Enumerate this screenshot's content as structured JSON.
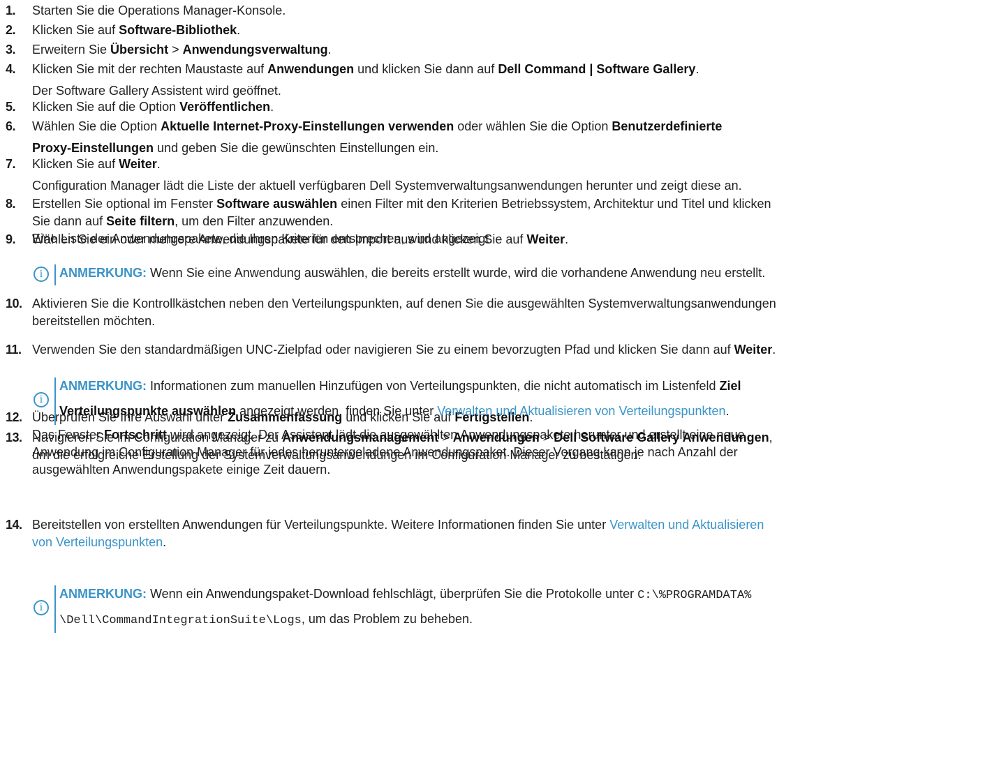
{
  "steps": [
    {
      "num": "1.",
      "lines": [
        [
          "Starten Sie die Operations Manager-Konsole."
        ]
      ]
    },
    {
      "num": "2.",
      "lines": [
        [
          "Klicken Sie auf ",
          {
            "b": "Software-Bibliothek"
          },
          "."
        ]
      ]
    },
    {
      "num": "3.",
      "lines": [
        [
          "Erweitern Sie ",
          {
            "b": "Übersicht"
          },
          " > ",
          {
            "b": "Anwendungsverwaltung"
          },
          "."
        ]
      ]
    },
    {
      "num": "4.",
      "lines": [
        [
          "Klicken Sie mit der rechten Maustaste auf ",
          {
            "b": "Anwendungen"
          },
          " und klicken Sie dann auf ",
          {
            "b": "Dell Command | Software Gallery"
          },
          "."
        ],
        [
          "Der Software Gallery Assistent wird geöffnet."
        ]
      ]
    },
    {
      "num": "5.",
      "lines": [
        [
          "Klicken Sie auf die Option ",
          {
            "b": "Veröffentlichen"
          },
          "."
        ]
      ]
    },
    {
      "num": "6.",
      "lines": [
        [
          "Wählen Sie die Option ",
          {
            "b": "Aktuelle Internet-Proxy-Einstellungen verwenden"
          },
          " oder wählen Sie die Option ",
          {
            "b": "Benutzerdefinierte"
          }
        ],
        [
          {
            "b": "Proxy-Einstellungen"
          },
          " und geben Sie die gewünschten Einstellungen ein."
        ]
      ]
    },
    {
      "num": "7.",
      "lines": [
        [
          "Klicken Sie auf ",
          {
            "b": "Weiter"
          },
          "."
        ],
        [
          "Configuration Manager lädt die Liste der aktuell verfügbaren Dell Systemverwaltungsanwendungen herunter und zeigt diese an."
        ]
      ]
    },
    {
      "num": "8.",
      "lines": [
        [
          "Erstellen Sie optional im Fenster ",
          {
            "b": "Software auswählen"
          },
          " einen Filter mit den Kriterien Betriebssystem, Architektur und Titel und klicken"
        ],
        [
          "Sie dann auf ",
          {
            "b": "Seite filtern"
          },
          ", um den Filter anzuwenden."
        ],
        [
          "Eine Liste der Anwendungspakete, die Ihren Kriterien entsprechen, wird angezeigt."
        ]
      ]
    },
    {
      "num": "9.",
      "lines": [
        [
          "Wählen Sie ein oder mehrere Anwendungspakete für den Import aus und klicken Sie auf ",
          {
            "b": "Weiter"
          },
          "."
        ]
      ]
    },
    {
      "num": "10.",
      "lines": [
        [
          "Aktivieren Sie die Kontrollkästchen neben den Verteilungspunkten, auf denen Sie die ausgewählten Systemverwaltungsanwendungen"
        ],
        [
          "bereitstellen möchten."
        ]
      ]
    },
    {
      "num": "11.",
      "lines": [
        [
          "Verwenden Sie den standardmäßigen UNC-Zielpfad oder navigieren Sie zu einem bevorzugten Pfad und klicken Sie dann auf ",
          {
            "b": "Weiter"
          },
          "."
        ]
      ]
    },
    {
      "num": "12.",
      "lines": [
        [
          "Überprüfen Sie Ihre Auswahl unter ",
          {
            "b": "Zusammenfassung"
          },
          " und klicken Sie auf ",
          {
            "b": "Fertigstellen"
          },
          "."
        ],
        [
          "Das Fenster ",
          {
            "b": "Fortschritt"
          },
          " wird angezeigt. Der Assistent lädt die ausgewählten Anwendungspakete herunter und erstellt eine neue"
        ],
        [
          "Anwendung im Configuration Manager für jedes heruntergeladene Anwendungspaket. Dieser Vorgang kann je nach Anzahl der"
        ],
        [
          "ausgewählten Anwendungspakete einige Zeit dauern."
        ]
      ]
    },
    {
      "num": "13.",
      "lines": [
        [
          "Navigieren Sie im Configuration Manager zu ",
          {
            "b": "Anwendungsmanagement"
          },
          " > ",
          {
            "b": "Anwendungen"
          },
          " > ",
          {
            "b": "Dell Software Gallery Anwendungen"
          },
          ","
        ],
        [
          "um die erfolgreiche Erstellung der Systemverwaltungsanwendungen im Configuration Manager zu bestätigen."
        ]
      ]
    },
    {
      "num": "14.",
      "lines": [
        [
          "Bereitstellen von erstellten Anwendungen für Verteilungspunkte. Weitere Informationen finden Sie unter ",
          {
            "link": "Verwalten und Aktualisieren"
          }
        ],
        [
          {
            "link": "von Verteilungspunkten"
          },
          "."
        ]
      ]
    }
  ],
  "notes": [
    {
      "label": "ANMERKUNG:",
      "lines": [
        [
          " Wenn Sie eine Anwendung auswählen, die bereits erstellt wurde, wird die vorhandene Anwendung neu erstellt."
        ]
      ]
    },
    {
      "label": "ANMERKUNG:",
      "lines": [
        [
          " Informationen zum manuellen Hinzufügen von Verteilungspunkten, die nicht automatisch im Listenfeld ",
          {
            "b": "Ziel"
          }
        ],
        [
          {
            "b": "Verteilungspunkte auswählen"
          },
          " angezeigt werden, finden Sie unter ",
          {
            "link": "Verwalten und Aktualisieren von Verteilungspunkten"
          },
          "."
        ]
      ]
    },
    {
      "label": "ANMERKUNG:",
      "lines": [
        [
          " Wenn ein Anwendungspaket-Download fehlschlägt, überprüfen Sie die Protokolle unter ",
          {
            "mono": "C:\\%PROGRAMDATA%"
          }
        ],
        [
          {
            "mono": "\\Dell\\CommandIntegrationSuite\\Logs"
          },
          ", um das Problem zu beheben."
        ]
      ]
    }
  ],
  "note_icon": "i"
}
